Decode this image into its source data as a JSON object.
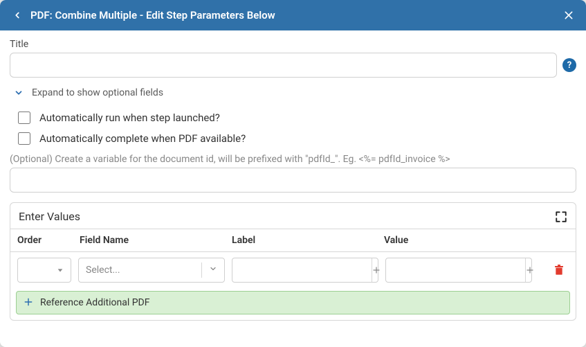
{
  "header": {
    "title": "PDF: Combine Multiple - Edit Step Parameters Below"
  },
  "form": {
    "title_label": "Title",
    "title_value": "",
    "expand_label": "Expand to show optional fields",
    "auto_run_label": "Automatically run when step launched?",
    "auto_complete_label": "Automatically complete when PDF available?",
    "variable_hint": "(Optional) Create a variable for the document id, will be prefixed with \"pdfId_\". Eg. <%= pdfId_invoice %>",
    "variable_value": ""
  },
  "panel": {
    "title": "Enter Values",
    "columns": {
      "order": "Order",
      "field": "Field Name",
      "label": "Label",
      "value": "Value"
    },
    "row": {
      "order": "",
      "field_placeholder": "Select...",
      "label_value": "",
      "value_value": ""
    },
    "reference_label": "Reference Additional PDF"
  },
  "icons": {
    "help": "?"
  }
}
